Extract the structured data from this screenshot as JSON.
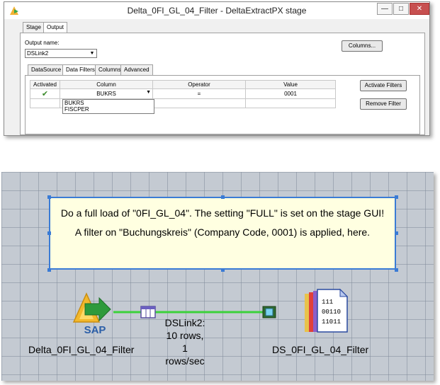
{
  "dialog": {
    "title": "Delta_0FI_GL_04_Filter - DeltaExtractPX stage",
    "tabs": [
      "Stage",
      "Output"
    ],
    "output_name_label": "Output name:",
    "output_name_value": "DSLink2",
    "columns_button": "Columns...",
    "subtabs": [
      "DataSource",
      "Data Filters",
      "Columns",
      "Advanced"
    ],
    "grid": {
      "headers": [
        "Activated",
        "Column",
        "Operator",
        "Value"
      ],
      "row": {
        "column": "BUKRS",
        "operator": "=",
        "value": "0001"
      }
    },
    "dropdown_options": [
      "BUKRS",
      "FISCPER"
    ],
    "activate_button": "Activate Filters",
    "remove_button": "Remove Filter"
  },
  "canvas": {
    "note_line1": "Do a full load of \"0FI_GL_04\". The setting \"FULL\" is set on the stage GUI!",
    "note_line2": "A filter on \"Buchungskreis\" (Company Code, 0001) is applied, here.",
    "source_stage": "Delta_0FI_GL_04_Filter",
    "source_badge": "SAP",
    "target_stage": "DS_0FI_GL_04_Filter",
    "file_icon_digits": [
      "111",
      "00110",
      "11011"
    ],
    "link_label": [
      "DSLink2:",
      "10 rows,",
      "1",
      "rows/sec"
    ]
  },
  "colors": {
    "link": "#3bd13b",
    "note_border": "#3a7bd5",
    "note_bg": "#ffffe1",
    "canvas_bg": "#c4cad2"
  }
}
